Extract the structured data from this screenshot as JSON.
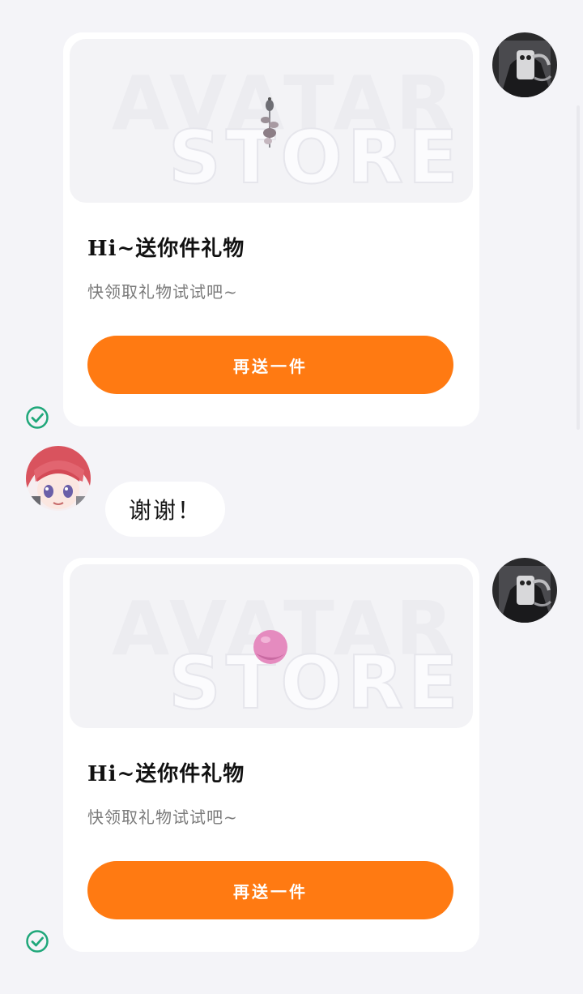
{
  "messages": [
    {
      "type": "gift",
      "sender": "self",
      "banner_text": [
        "AVATAR",
        "STORE"
      ],
      "item": "rose-icon",
      "title": "Hi~送你件礼物",
      "subtitle": "快领取礼物试试吧~",
      "button_label": "再送一件",
      "status": "sent-check-icon"
    },
    {
      "type": "text",
      "sender": "other",
      "text": "谢谢！"
    },
    {
      "type": "gift",
      "sender": "self",
      "banner_text": [
        "AVATAR",
        "STORE"
      ],
      "item": "pink-ball-icon",
      "title": "Hi~送你件礼物",
      "subtitle": "快领取礼物试试吧~",
      "button_label": "再送一件",
      "status": "sent-check-icon"
    }
  ],
  "colors": {
    "background": "#f4f4f8",
    "button": "#ff7a12",
    "check": "#1fa77a"
  }
}
